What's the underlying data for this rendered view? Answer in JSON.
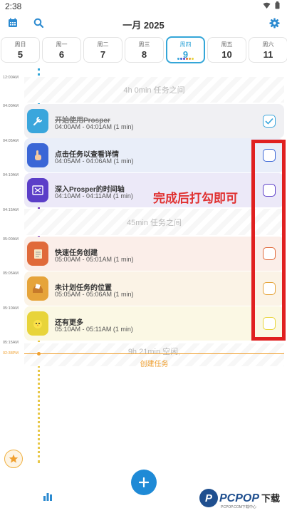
{
  "status_bar": {
    "time": "2:38"
  },
  "header": {
    "title": "一月 2025",
    "icons": [
      "calendar-icon",
      "search-icon",
      "gear-icon"
    ]
  },
  "week": [
    {
      "name": "周日",
      "num": "5",
      "active": false
    },
    {
      "name": "周一",
      "num": "6",
      "active": false
    },
    {
      "name": "周二",
      "num": "7",
      "active": false
    },
    {
      "name": "周三",
      "num": "8",
      "active": false
    },
    {
      "name": "周四",
      "num": "9",
      "active": true
    },
    {
      "name": "周五",
      "num": "10",
      "active": false
    },
    {
      "name": "周六",
      "num": "11",
      "active": false
    }
  ],
  "time_labels": [
    "12:00AM",
    "04:00AM",
    "04:05AM",
    "04:10AM",
    "04:15AM",
    "05:00AM",
    "05:05AM",
    "05:10AM",
    "05:15AM",
    "02:38PM"
  ],
  "gaps": [
    {
      "text": "4h 0min 任务之间",
      "link": ""
    },
    {
      "text": "45min 任务之间",
      "link": ""
    },
    {
      "text": "9h 21min 空闲,",
      "link": "创建任务"
    }
  ],
  "tasks": [
    {
      "title": "开始使用Prosper",
      "time": "04:00AM - 04:01AM (1 min)",
      "done": true,
      "icon": "wrench-icon",
      "color": "#3aa6dc",
      "bg": "#f0f0f3",
      "check": "#3aa6dc"
    },
    {
      "title": "点击任务以查看详情",
      "time": "04:05AM - 04:06AM (1 min)",
      "done": false,
      "icon": "hand-pointer-icon",
      "color": "#3a66d6",
      "bg": "#e9eef9",
      "check": "#3a66d6"
    },
    {
      "title": "深入Prosper的时间轴",
      "time": "04:10AM - 04:11AM (1 min)",
      "done": false,
      "icon": "timeline-icon",
      "color": "#5b3ec8",
      "bg": "#ece9f8",
      "check": "#5b3ec8"
    },
    {
      "title": "快速任务创建",
      "time": "05:00AM - 05:01AM (1 min)",
      "done": false,
      "icon": "notepad-icon",
      "color": "#e06a3a",
      "bg": "#fbeee9",
      "check": "#e06a3a"
    },
    {
      "title": "未计划任务的位置",
      "time": "05:05AM - 05:06AM (1 min)",
      "done": false,
      "icon": "inbox-icon",
      "color": "#e6a43a",
      "bg": "#fbf3e6",
      "check": "#e6a43a"
    },
    {
      "title": "还有更多",
      "time": "05:10AM - 05:11AM (1 min)",
      "done": false,
      "icon": "chick-icon",
      "color": "#e8d43a",
      "bg": "#fbf8e4",
      "check": "#e8d43a"
    }
  ],
  "annotation": {
    "text": "完成后打勾即可"
  },
  "watermark": {
    "badge": "P",
    "brand": "PCPOP",
    "cn": "下载",
    "sub": "PCPOP.COM下载中心"
  },
  "colors": {
    "accent": "#34a6d8",
    "now": "#f0a030",
    "fab": "#1f8ad6",
    "annotation": "#e02020"
  }
}
